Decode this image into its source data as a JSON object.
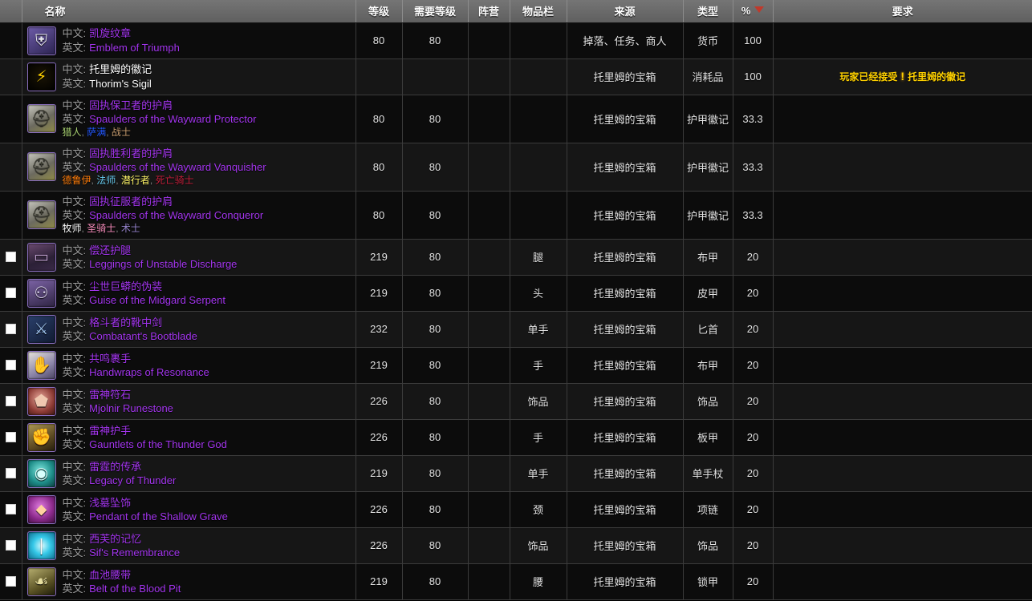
{
  "table": {
    "name": "item-listview",
    "columns": [
      {
        "key": "check",
        "label": ""
      },
      {
        "key": "name",
        "label": "名称"
      },
      {
        "key": "level",
        "label": "等级"
      },
      {
        "key": "reqlvl",
        "label": "需要等级"
      },
      {
        "key": "side",
        "label": "阵营"
      },
      {
        "key": "slot",
        "label": "物品栏"
      },
      {
        "key": "source",
        "label": "来源"
      },
      {
        "key": "type",
        "label": "类型"
      },
      {
        "key": "pct",
        "label": "%"
      },
      {
        "key": "req",
        "label": "要求"
      }
    ],
    "sort": {
      "column": "%",
      "direction": "desc",
      "indicator_color": "#c0392b"
    },
    "labels": {
      "zh": "中文:",
      "en": "英文:"
    },
    "rows": [
      {
        "checkbox": false,
        "icon": "emblem-of-triumph-icon",
        "icon_glyph": "⛨",
        "icon_bg": "linear-gradient(145deg,#6d5ba8,#2b2350)",
        "quality": "epic",
        "name_zh": "凯旋纹章",
        "name_en": "Emblem of Triumph",
        "classes": [],
        "level": "80",
        "reqlvl": "80",
        "side": "",
        "slot": "",
        "source": "掉落、任务、商人",
        "type": "货币",
        "pct": "100",
        "req": ""
      },
      {
        "checkbox": false,
        "icon": "thorims-sigil-icon",
        "icon_glyph": "⚡",
        "icon_bg": "radial-gradient(circle at 50% 45%,#1a1405,#000)",
        "glyph_color": "#ffd100",
        "quality": "common",
        "name_zh": "托里姆的徽记",
        "name_en": "Thorim's Sigil",
        "classes": [],
        "level": "",
        "reqlvl": "",
        "side": "",
        "slot": "",
        "source": "托里姆的宝箱",
        "type": "消耗品",
        "pct": "100",
        "req": "玩家已经接受",
        "req_quest": "托里姆的徽记"
      },
      {
        "checkbox": false,
        "icon": "spaulders-protector-icon",
        "icon_glyph": "⛑",
        "icon_bg": "linear-gradient(150deg,#c8c8c0,#6c6a5f 55%,#8f8a46)",
        "glyph_color": "#3a3a30",
        "quality": "epic",
        "name_zh": "固执保卫者的护肩",
        "name_en": "Spaulders of the Wayward Protector",
        "classes": [
          {
            "name": "猎人",
            "color": "#abd473"
          },
          {
            "name": "萨满",
            "color": "#2459ff"
          },
          {
            "name": "战士",
            "color": "#c79c6e"
          }
        ],
        "level": "80",
        "reqlvl": "80",
        "side": "",
        "slot": "",
        "source": "托里姆的宝箱",
        "type": "护甲徽记",
        "pct": "33.3",
        "req": ""
      },
      {
        "checkbox": false,
        "icon": "spaulders-vanquisher-icon",
        "icon_glyph": "⛑",
        "icon_bg": "linear-gradient(150deg,#c8c8c0,#6c6a5f 55%,#8f8a46)",
        "glyph_color": "#3a3a30",
        "quality": "epic",
        "name_zh": "固执胜利者的护肩",
        "name_en": "Spaulders of the Wayward Vanquisher",
        "classes": [
          {
            "name": "德鲁伊",
            "color": "#ff7d0a"
          },
          {
            "name": "法师",
            "color": "#69ccf0"
          },
          {
            "name": "潜行者",
            "color": "#fff569"
          },
          {
            "name": "死亡骑士",
            "color": "#c41f3b"
          }
        ],
        "level": "80",
        "reqlvl": "80",
        "side": "",
        "slot": "",
        "source": "托里姆的宝箱",
        "type": "护甲徽记",
        "pct": "33.3",
        "req": ""
      },
      {
        "checkbox": false,
        "icon": "spaulders-conqueror-icon",
        "icon_glyph": "⛑",
        "icon_bg": "linear-gradient(150deg,#c8c8c0,#6c6a5f 55%,#8f8a46)",
        "glyph_color": "#3a3a30",
        "quality": "epic",
        "name_zh": "固执征服者的护肩",
        "name_en": "Spaulders of the Wayward Conqueror",
        "classes": [
          {
            "name": "牧师",
            "color": "#ffffff"
          },
          {
            "name": "圣骑士",
            "color": "#f58cba"
          },
          {
            "name": "术士",
            "color": "#9482c9"
          }
        ],
        "level": "80",
        "reqlvl": "80",
        "side": "",
        "slot": "",
        "source": "托里姆的宝箱",
        "type": "护甲徽记",
        "pct": "33.3",
        "req": ""
      },
      {
        "checkbox": false,
        "icon": "leggings-unstable-discharge-icon",
        "icon_glyph": "▭",
        "icon_bg": "linear-gradient(160deg,#6b4a70,#2b2036 60%,#3a2a48)",
        "glyph_color": "#c0a0d0",
        "quality": "epic",
        "name_zh": "偿还护腿",
        "name_en": "Leggings of Unstable Discharge",
        "classes": [],
        "level": "219",
        "reqlvl": "80",
        "side": "",
        "slot": "腿",
        "source": "托里姆的宝箱",
        "type": "布甲",
        "pct": "20",
        "req": ""
      },
      {
        "checkbox": false,
        "icon": "guise-midgard-serpent-icon",
        "icon_glyph": "⚇",
        "icon_bg": "linear-gradient(160deg,#7c63a6,#2e2442)",
        "glyph_color": "#e0d8f0",
        "quality": "epic",
        "name_zh": "尘世巨蟒的伪装",
        "name_en": "Guise of the Midgard Serpent",
        "classes": [],
        "level": "219",
        "reqlvl": "80",
        "side": "",
        "slot": "头",
        "source": "托里姆的宝箱",
        "type": "皮甲",
        "pct": "20",
        "req": ""
      },
      {
        "checkbox": false,
        "icon": "combatants-bootblade-icon",
        "icon_glyph": "⚔",
        "icon_bg": "linear-gradient(140deg,#2a3f6b,#101a30)",
        "glyph_color": "#9fc4ee",
        "quality": "epic",
        "name_zh": "格斗者的靴中剑",
        "name_en": "Combatant's Bootblade",
        "classes": [],
        "level": "232",
        "reqlvl": "80",
        "side": "",
        "slot": "单手",
        "source": "托里姆的宝箱",
        "type": "匕首",
        "pct": "20",
        "req": ""
      },
      {
        "checkbox": false,
        "icon": "handwraps-of-resonance-icon",
        "icon_glyph": "✋",
        "icon_bg": "linear-gradient(150deg,#e8e4dc,#8b84a8 60%,#4a4360)",
        "glyph_color": "#4a4360",
        "quality": "epic",
        "name_zh": "共鸣裹手",
        "name_en": "Handwraps of Resonance",
        "classes": [],
        "level": "219",
        "reqlvl": "80",
        "side": "",
        "slot": "手",
        "source": "托里姆的宝箱",
        "type": "布甲",
        "pct": "20",
        "req": ""
      },
      {
        "checkbox": false,
        "icon": "mjolnir-runestone-icon",
        "icon_glyph": "⬟",
        "icon_bg": "radial-gradient(circle at 45% 40%,#e8a79a,#8c3a34 60%,#3a1612)",
        "glyph_color": "#f0c8b0",
        "quality": "epic",
        "name_zh": "雷神符石",
        "name_en": "Mjolnir Runestone",
        "classes": [],
        "level": "226",
        "reqlvl": "80",
        "side": "",
        "slot": "饰品",
        "source": "托里姆的宝箱",
        "type": "饰品",
        "pct": "20",
        "req": ""
      },
      {
        "checkbox": false,
        "icon": "gauntlets-thunder-god-icon",
        "icon_glyph": "✊",
        "icon_bg": "linear-gradient(150deg,#b09a54,#5c4a22 60%,#241c0c)",
        "glyph_color": "#ddc88c",
        "quality": "epic",
        "name_zh": "雷神护手",
        "name_en": "Gauntlets of the Thunder God",
        "classes": [],
        "level": "226",
        "reqlvl": "80",
        "side": "",
        "slot": "手",
        "source": "托里姆的宝箱",
        "type": "板甲",
        "pct": "20",
        "req": ""
      },
      {
        "checkbox": false,
        "icon": "legacy-of-thunder-icon",
        "icon_glyph": "◉",
        "icon_bg": "radial-gradient(circle at 45% 40%,#7fe8e0,#1d8c88 55%,#0c3a3c)",
        "glyph_color": "#d8fffc",
        "quality": "epic",
        "name_zh": "雷霆的传承",
        "name_en": "Legacy of Thunder",
        "classes": [],
        "level": "219",
        "reqlvl": "80",
        "side": "",
        "slot": "单手",
        "source": "托里姆的宝箱",
        "type": "单手杖",
        "pct": "20",
        "req": ""
      },
      {
        "checkbox": false,
        "icon": "pendant-shallow-grave-icon",
        "icon_glyph": "⬥",
        "icon_bg": "radial-gradient(circle at 45% 40%,#e07ce0,#8c2a8c 55%,#3a0e3a)",
        "glyph_color": "#ffd0a0",
        "quality": "epic",
        "name_zh": "浅墓坠饰",
        "name_en": "Pendant of the Shallow Grave",
        "classes": [],
        "level": "226",
        "reqlvl": "80",
        "side": "",
        "slot": "颈",
        "source": "托里姆的宝箱",
        "type": "项链",
        "pct": "20",
        "req": ""
      },
      {
        "checkbox": false,
        "icon": "sifs-remembrance-icon",
        "icon_glyph": "❘",
        "icon_bg": "radial-gradient(circle at 50% 50%,#d8fbff,#35c8e8 45%,#0d6a8c)",
        "glyph_color": "#ffffff",
        "quality": "epic",
        "name_zh": "西芙的记忆",
        "name_en": "Sif's Remembrance",
        "classes": [],
        "level": "226",
        "reqlvl": "80",
        "side": "",
        "slot": "饰品",
        "source": "托里姆的宝箱",
        "type": "饰品",
        "pct": "20",
        "req": ""
      },
      {
        "checkbox": false,
        "icon": "belt-of-blood-pit-icon",
        "icon_glyph": "☙",
        "icon_bg": "linear-gradient(150deg,#b8b070,#5a5224 60%,#1c1a08)",
        "glyph_color": "#e8e0a0",
        "quality": "epic",
        "name_zh": "血池腰带",
        "name_en": "Belt of the Blood Pit",
        "classes": [],
        "level": "219",
        "reqlvl": "80",
        "side": "",
        "slot": "腰",
        "source": "托里姆的宝箱",
        "type": "锁甲",
        "pct": "20",
        "req": ""
      }
    ]
  }
}
